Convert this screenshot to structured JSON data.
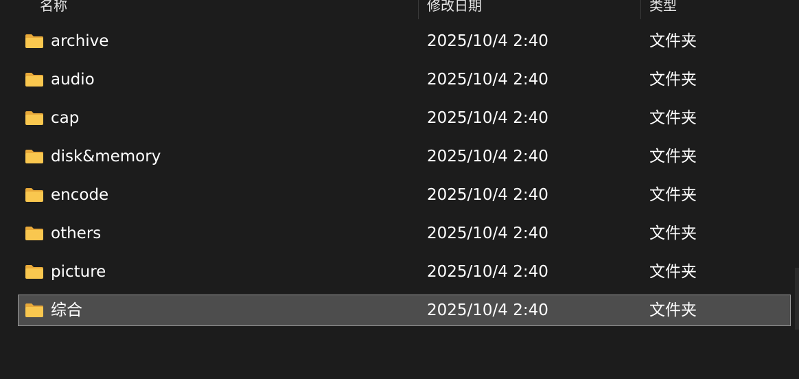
{
  "columns": {
    "name": "名称",
    "modified": "修改日期",
    "type": "类型"
  },
  "rows": [
    {
      "name": "archive",
      "modified": "2025/10/4 2:40",
      "type": "文件夹",
      "icon": "folder-icon"
    },
    {
      "name": "audio",
      "modified": "2025/10/4 2:40",
      "type": "文件夹",
      "icon": "folder-icon"
    },
    {
      "name": "cap",
      "modified": "2025/10/4 2:40",
      "type": "文件夹",
      "icon": "folder-icon"
    },
    {
      "name": "disk&memory",
      "modified": "2025/10/4 2:40",
      "type": "文件夹",
      "icon": "folder-icon"
    },
    {
      "name": "encode",
      "modified": "2025/10/4 2:40",
      "type": "文件夹",
      "icon": "folder-icon"
    },
    {
      "name": "others",
      "modified": "2025/10/4 2:40",
      "type": "文件夹",
      "icon": "folder-icon"
    },
    {
      "name": "picture",
      "modified": "2025/10/4 2:40",
      "type": "文件夹",
      "icon": "folder-icon"
    },
    {
      "name": "综合",
      "modified": "2025/10/4 2:40",
      "type": "文件夹",
      "icon": "folder-icon",
      "selected": true
    }
  ],
  "colors": {
    "background": "#1c1c1c",
    "selected_row": "#4d4d4d",
    "folder_body": "#f9c74f",
    "folder_tab": "#e8a93a"
  }
}
